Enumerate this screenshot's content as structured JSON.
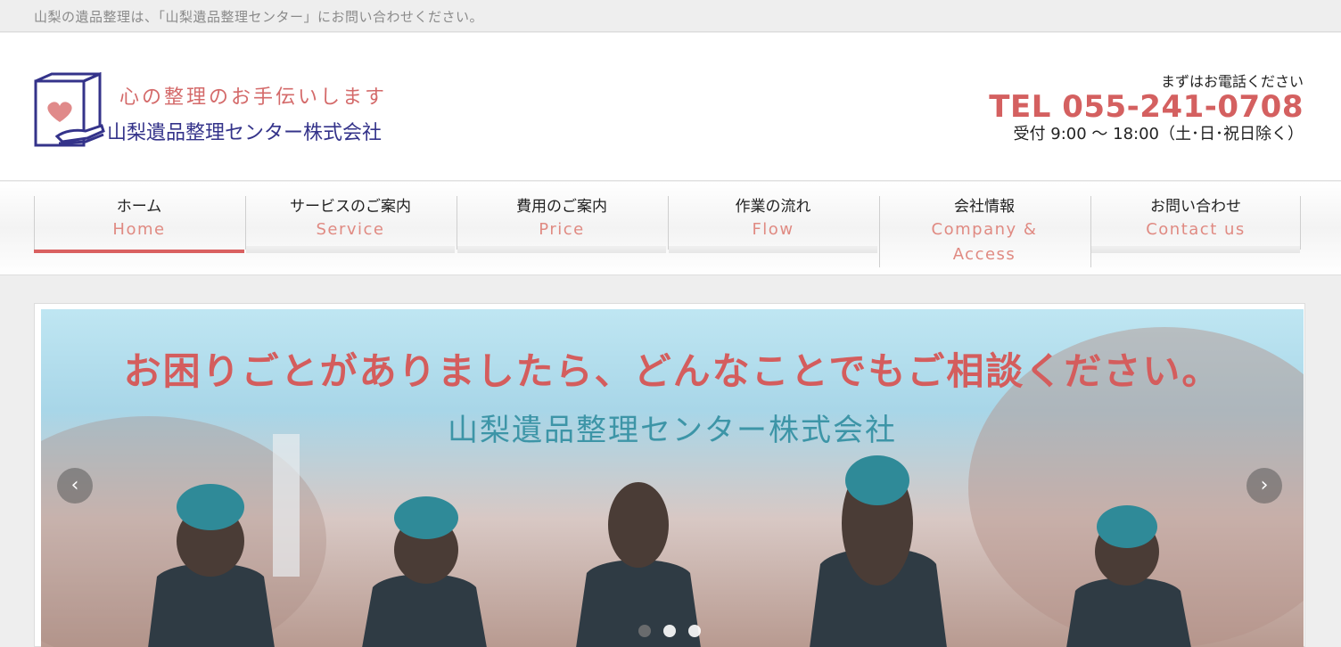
{
  "topbar": {
    "text": "山梨の遺品整理は、「山梨遺品整理センター」にお問い合わせください。"
  },
  "logo": {
    "tagline": "心の整理のお手伝いします",
    "company": "山梨遺品整理センター株式会社"
  },
  "contact": {
    "lead": "まずはお電話ください",
    "tel": "TEL 055-241-0708",
    "hours": "受付 9:00 ～ 18:00（土･日･祝日除く）"
  },
  "nav": [
    {
      "jp": "ホーム",
      "en": "Home",
      "active": true
    },
    {
      "jp": "サービスのご案内",
      "en": "Service"
    },
    {
      "jp": "費用のご案内",
      "en": "Price"
    },
    {
      "jp": "作業の流れ",
      "en": "Flow"
    },
    {
      "jp": "会社情報",
      "en": "Company &",
      "en2": "Access"
    },
    {
      "jp": "お問い合わせ",
      "en": "Contact us"
    }
  ],
  "slider": {
    "headline": "お困りごとがありましたら、どんなことでもご相談ください。",
    "subline": "山梨遺品整理センター株式会社",
    "prev_glyph": "‹",
    "next_glyph": "›",
    "active_slide": 1,
    "slide_count": 3
  },
  "colors": {
    "accent": "#d96060",
    "brand_navy": "#34338a",
    "teal": "#3d95a7"
  }
}
